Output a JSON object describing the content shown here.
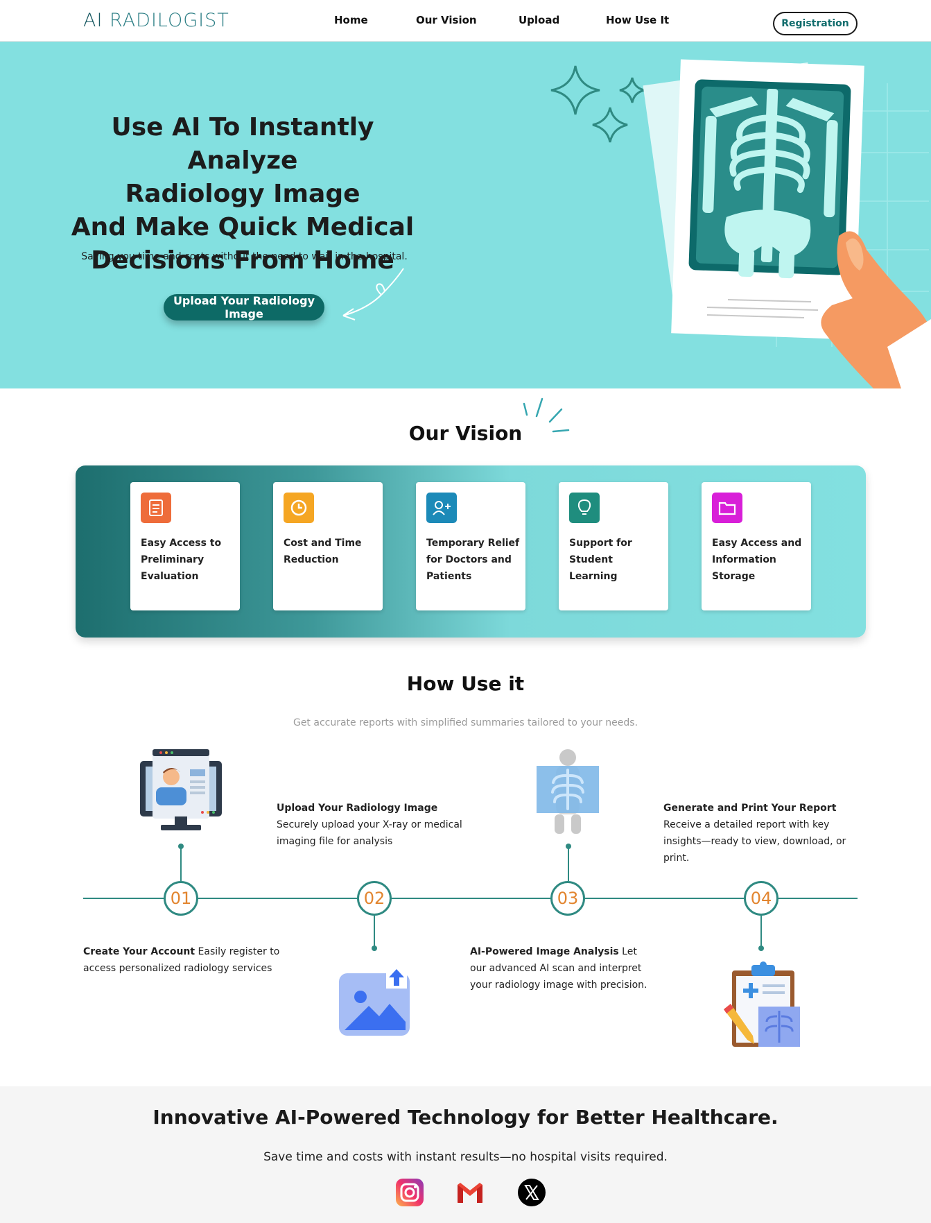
{
  "nav": {
    "logo_ai": "AI",
    "logo_rest": "RADILOGIST",
    "links": [
      "Home",
      "Our Vision",
      "Upload",
      "How Use It"
    ],
    "register_label": "Registration"
  },
  "hero": {
    "title_lines": [
      "Use AI To Instantly Analyze",
      "Radiology Image",
      "And Make Quick Medical",
      "Decisions From Home"
    ],
    "subtitle": "Saving you time and costs without the need to wait in the hospital.",
    "cta_label": "Upload Your Radiology Image",
    "bg_color": "#83e0e0"
  },
  "vision": {
    "title": "Our Vision",
    "cards": [
      {
        "label": "Easy Access to Preliminary Evaluation",
        "icon": "document-icon",
        "color": "#ee6c3a"
      },
      {
        "label": "Cost and Time Reduction",
        "icon": "clock-icon",
        "color": "#f5a623"
      },
      {
        "label": "Temporary Relief for Doctors and Patients",
        "icon": "add-user-icon",
        "color": "#1c8ab8"
      },
      {
        "label": "Support for Student Learning",
        "icon": "lightbulb-icon",
        "color": "#1f8d7e"
      },
      {
        "label": "Easy Access and Information Storage",
        "icon": "folder-icon",
        "color": "#d81fd8"
      }
    ]
  },
  "how": {
    "title": "How Use it",
    "subtitle": "Get accurate reports with simplified summaries tailored to your needs.",
    "steps": [
      {
        "num": "01",
        "bold": "Create Your Account",
        "text": " Easily register to access personalized radiology services",
        "illu": "computer-profile-icon"
      },
      {
        "num": "02",
        "bold": "Upload Your Radiology Image",
        "text": " Securely upload your X-ray or medical imaging file for analysis",
        "illu": "image-upload-icon"
      },
      {
        "num": "03",
        "bold": "AI-Powered Image Analysis",
        "text": " Let our advanced AI scan and interpret your radiology image with precision.",
        "illu": "xray-body-icon"
      },
      {
        "num": "04",
        "bold": "Generate and Print Your Report",
        "text": " Receive a detailed report with key insights—ready to view, download, or print.",
        "illu": "clipboard-report-icon"
      }
    ]
  },
  "footer": {
    "title": "Innovative AI-Powered Technology for Better Healthcare.",
    "subtitle": "Save time and costs with instant results—no hospital visits required.",
    "social": [
      "instagram-icon",
      "gmail-icon",
      "x-icon"
    ]
  }
}
